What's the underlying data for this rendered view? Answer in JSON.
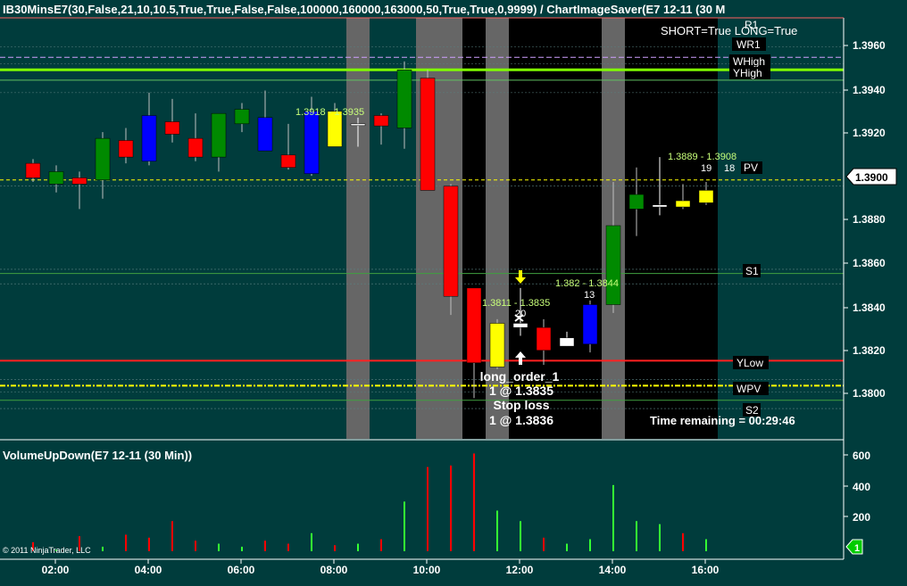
{
  "header": {
    "title": "IB30MinsE7(30,False,21,10,10.5,True,True,False,False,100000,160000,163000,50,True,True,0,9999)  /  ChartImageSaver(E7  12-11  (30  M",
    "signal_text": "SHORT=True LONG=True"
  },
  "price_axis": {
    "labels": [
      "1.3960",
      "1.3940",
      "1.3920",
      "1.3900",
      "1.3880",
      "1.3860",
      "1.3840",
      "1.3820",
      "1.3800"
    ],
    "current_price": "1.3900"
  },
  "level_labels": {
    "wr1": "WR1",
    "whigh": "WHigh",
    "yhigh": "YHigh",
    "r1": "R1",
    "pv": "PV",
    "s1": "S1",
    "ylow": "YLow",
    "wpv": "WPV",
    "s2": "S2"
  },
  "annotations": {
    "a1": "1.3918 - 1.3935",
    "a2": "1.3811 - 1.3835",
    "a3": "20",
    "a4": "1.382 - 1.3844",
    "a5": "13",
    "a6": "1.3889 - 1.3908",
    "a7": "19",
    "a8": "18",
    "order_line1": "long_order_1",
    "order_line2": "1 @ 1.3835",
    "order_line3": "Stop loss",
    "order_line4": "1 @ 1.3836",
    "time_remaining": "Time remaining = 00:29:46"
  },
  "volume_panel": {
    "title": "VolumeUpDown(E7 12-11 (30 Min))",
    "labels": [
      "600",
      "400",
      "200"
    ],
    "marker": "1"
  },
  "copyright": "© 2011 NinjaTrader, LLC",
  "time_axis": [
    "02:00",
    "04:00",
    "06:00",
    "08:00",
    "10:00",
    "12:00",
    "14:00",
    "16:00"
  ],
  "chart_data": {
    "type": "candlestick",
    "instrument": "E7 12-11 (30 Min)",
    "candles": [
      {
        "o": 1.391,
        "h": 1.3912,
        "l": 1.3901,
        "c": 1.3903,
        "color": "red"
      },
      {
        "o": 1.39,
        "h": 1.3909,
        "l": 1.3896,
        "c": 1.3906,
        "color": "green"
      },
      {
        "o": 1.3903,
        "h": 1.3906,
        "l": 1.3888,
        "c": 1.39,
        "color": "red"
      },
      {
        "o": 1.3902,
        "h": 1.3925,
        "l": 1.3893,
        "c": 1.3922,
        "color": "green"
      },
      {
        "o": 1.3921,
        "h": 1.3927,
        "l": 1.391,
        "c": 1.3913,
        "color": "red"
      },
      {
        "o": 1.3911,
        "h": 1.3944,
        "l": 1.3909,
        "c": 1.3933,
        "color": "blue"
      },
      {
        "o": 1.393,
        "h": 1.3941,
        "l": 1.392,
        "c": 1.3924,
        "color": "red"
      },
      {
        "o": 1.3922,
        "h": 1.3934,
        "l": 1.3911,
        "c": 1.3913,
        "color": "red"
      },
      {
        "o": 1.3913,
        "h": 1.3932,
        "l": 1.3906,
        "c": 1.3934,
        "color": "green"
      },
      {
        "o": 1.3929,
        "h": 1.3939,
        "l": 1.3925,
        "c": 1.3936,
        "color": "green"
      },
      {
        "o": 1.3932,
        "h": 1.3945,
        "l": 1.3916,
        "c": 1.3916,
        "color": "blue"
      },
      {
        "o": 1.3914,
        "h": 1.3929,
        "l": 1.3907,
        "c": 1.3908,
        "color": "red"
      },
      {
        "o": 1.3935,
        "h": 1.3942,
        "l": 1.3904,
        "c": 1.3905,
        "color": "blue"
      },
      {
        "o": 1.3935,
        "h": 1.3939,
        "l": 1.3918,
        "c": 1.3918,
        "color": "yellow"
      },
      {
        "o": 1.3929,
        "h": 1.3932,
        "l": 1.3918,
        "c": 1.3929,
        "color": "white"
      },
      {
        "o": 1.3933,
        "h": 1.3934,
        "l": 1.3919,
        "c": 1.3928,
        "color": "red"
      },
      {
        "o": 1.3927,
        "h": 1.3959,
        "l": 1.3917,
        "c": 1.3955,
        "color": "green"
      },
      {
        "o": 1.3951,
        "h": 1.3955,
        "l": 1.3897,
        "c": 1.3897,
        "color": "red"
      },
      {
        "o": 1.3899,
        "h": 1.39,
        "l": 1.3837,
        "c": 1.3846,
        "color": "red"
      },
      {
        "o": 1.385,
        "h": 1.385,
        "l": 1.3797,
        "c": 1.3814,
        "color": "red"
      },
      {
        "o": 1.3833,
        "h": 1.3835,
        "l": 1.3811,
        "c": 1.3812,
        "color": "yellow"
      },
      {
        "o": 1.3833,
        "h": 1.385,
        "l": 1.3827,
        "c": 1.3831,
        "color": "white"
      },
      {
        "o": 1.3831,
        "h": 1.3835,
        "l": 1.3813,
        "c": 1.382,
        "color": "red"
      },
      {
        "o": 1.3826,
        "h": 1.3829,
        "l": 1.3822,
        "c": 1.3822,
        "color": "white"
      },
      {
        "o": 1.3842,
        "h": 1.3844,
        "l": 1.3819,
        "c": 1.3823,
        "color": "blue"
      },
      {
        "o": 1.3842,
        "h": 1.3901,
        "l": 1.3838,
        "c": 1.388,
        "color": "green"
      },
      {
        "o": 1.3888,
        "h": 1.3908,
        "l": 1.3875,
        "c": 1.3895,
        "color": "green"
      },
      {
        "o": 1.3889,
        "h": 1.3913,
        "l": 1.3885,
        "c": 1.389,
        "color": "white"
      },
      {
        "o": 1.3892,
        "h": 1.39,
        "l": 1.3888,
        "c": 1.3889,
        "color": "yellow"
      },
      {
        "o": 1.3897,
        "h": 1.3901,
        "l": 1.389,
        "c": 1.3891,
        "color": "yellow"
      }
    ],
    "volume": [
      {
        "v": 0,
        "color": "green"
      },
      {
        "v": 60,
        "color": "red"
      },
      {
        "v": 10,
        "color": "green"
      },
      {
        "v": 100,
        "color": "red"
      },
      {
        "v": 30,
        "color": "green"
      },
      {
        "v": 110,
        "color": "red"
      },
      {
        "v": 90,
        "color": "red"
      },
      {
        "v": 200,
        "color": "red"
      },
      {
        "v": 70,
        "color": "red"
      },
      {
        "v": 50,
        "color": "green"
      },
      {
        "v": 30,
        "color": "green"
      },
      {
        "v": 70,
        "color": "red"
      },
      {
        "v": 50,
        "color": "red"
      },
      {
        "v": 120,
        "color": "green"
      },
      {
        "v": 40,
        "color": "red"
      },
      {
        "v": 50,
        "color": "green"
      },
      {
        "v": 80,
        "color": "red"
      },
      {
        "v": 330,
        "color": "green"
      },
      {
        "v": 560,
        "color": "red"
      },
      {
        "v": 570,
        "color": "red"
      },
      {
        "v": 650,
        "color": "red"
      },
      {
        "v": 270,
        "color": "green"
      },
      {
        "v": 200,
        "color": "green"
      },
      {
        "v": 90,
        "color": "red"
      },
      {
        "v": 50,
        "color": "green"
      },
      {
        "v": 80,
        "color": "green"
      },
      {
        "v": 440,
        "color": "green"
      },
      {
        "v": 200,
        "color": "green"
      },
      {
        "v": 180,
        "color": "green"
      },
      {
        "v": 120,
        "color": "red"
      },
      {
        "v": 80,
        "color": "green"
      }
    ],
    "levels": {
      "WR1": 1.3961,
      "WHigh": 1.3955,
      "YHigh": 1.395,
      "PV": 1.3902,
      "S1": 1.3857,
      "YLow": 1.3815,
      "WPV": 1.3803,
      "S2": 1.3796
    },
    "ylim": [
      1.3786,
      1.398
    ],
    "volume_ylim": [
      0,
      700
    ],
    "colors": {
      "background": "#003c3c",
      "session": "#000000",
      "band": "#666666",
      "green": "#008a00",
      "red": "#ff0000",
      "blue": "#0000ff",
      "yellow": "#ffff00",
      "white": "#ffffff",
      "level_green": "#80ff00",
      "level_red": "#ff2020",
      "level_yellow": "#ffff00"
    }
  }
}
